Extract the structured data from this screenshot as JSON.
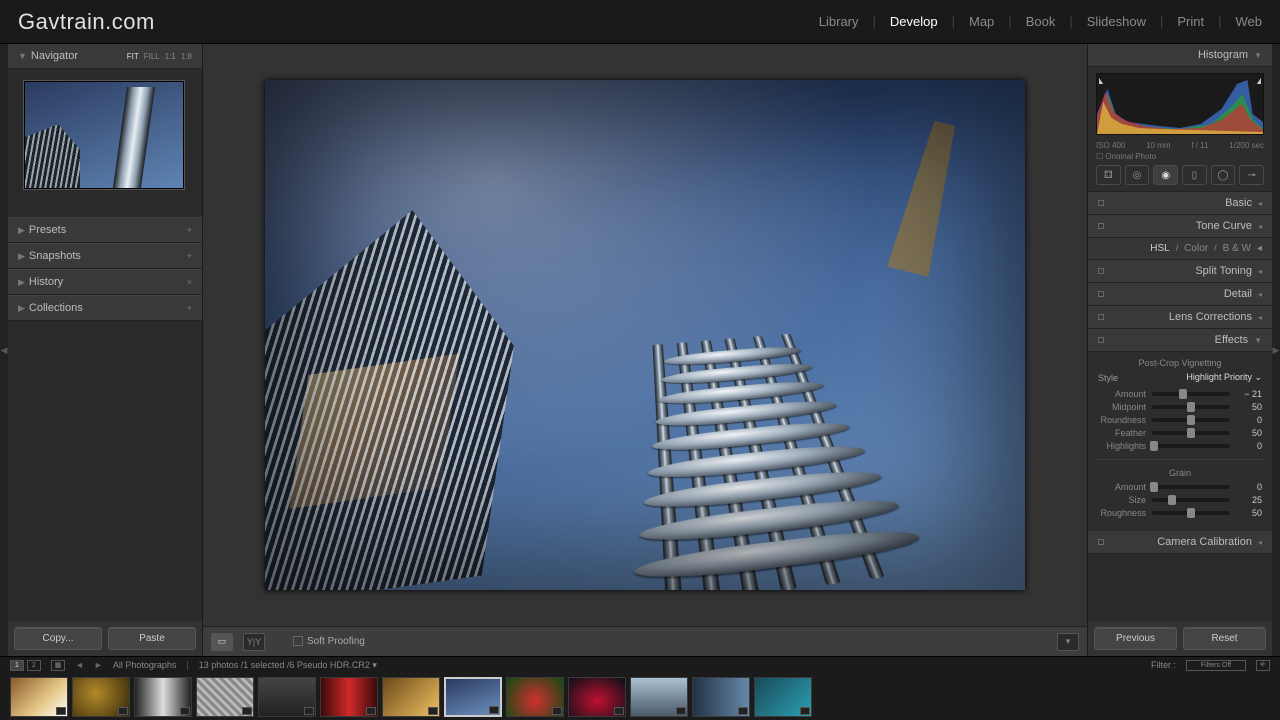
{
  "brand": "Gavtrain.com",
  "modules": [
    "Library",
    "Develop",
    "Map",
    "Book",
    "Slideshow",
    "Print",
    "Web"
  ],
  "active_module_index": 1,
  "left": {
    "navigator": "Navigator",
    "zoom": [
      "FIT",
      "FILL",
      "1:1",
      "1:8"
    ],
    "zoom_sel": 0,
    "panels": [
      {
        "label": "Presets",
        "ctl": "+"
      },
      {
        "label": "Snapshots",
        "ctl": "+"
      },
      {
        "label": "History",
        "ctl": "×"
      },
      {
        "label": "Collections",
        "ctl": "+"
      }
    ],
    "copy": "Copy...",
    "paste": "Paste"
  },
  "center": {
    "view_loupe": "▭",
    "view_compare": "Y|Y",
    "soft_proof": "Soft Proofing"
  },
  "right": {
    "histogram": "Histogram",
    "meta": {
      "iso": "ISO 400",
      "focal": "10 mm",
      "aperture": "f / 11",
      "shutter": "1/200 sec"
    },
    "orig": "Original Photo",
    "panels": [
      "Basic",
      "Tone Curve"
    ],
    "hsl": {
      "label": "HSL",
      "color": "Color",
      "bw": "B & W"
    },
    "panels2": [
      "Split Toning",
      "Detail",
      "Lens Corrections"
    ],
    "effects": {
      "title": "Effects",
      "vign_head": "Post-Crop Vignetting",
      "style_lbl": "Style",
      "style_val": "Highlight Priority",
      "sliders": [
        {
          "lbl": "Amount",
          "val": "− 21",
          "pos": 40
        },
        {
          "lbl": "Midpoint",
          "val": "50",
          "pos": 50
        },
        {
          "lbl": "Roundness",
          "val": "0",
          "pos": 50
        },
        {
          "lbl": "Feather",
          "val": "50",
          "pos": 50
        },
        {
          "lbl": "Highlights",
          "val": "0",
          "pos": 2
        }
      ],
      "grain_head": "Grain",
      "grain": [
        {
          "lbl": "Amount",
          "val": "0",
          "pos": 2
        },
        {
          "lbl": "Size",
          "val": "25",
          "pos": 25
        },
        {
          "lbl": "Roughness",
          "val": "50",
          "pos": 50
        }
      ]
    },
    "calib": "Camera Calibration",
    "prev": "Previous",
    "reset": "Reset"
  },
  "filmstrip": {
    "source": "All Photographs",
    "count": "13 photos",
    "sel": "1 selected",
    "file": "6 Pseudo HDR.CR2",
    "filter_lbl": "Filter :",
    "filter_val": "Filters Off",
    "selected_index": 7
  }
}
